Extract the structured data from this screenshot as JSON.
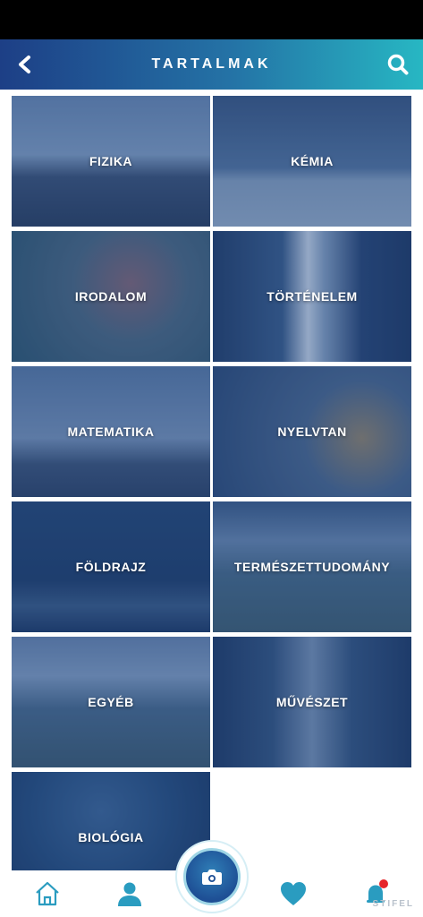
{
  "header": {
    "title": "TARTALMAK",
    "back_icon": "chevron-left-icon",
    "search_icon": "search-icon"
  },
  "categories": [
    {
      "label": "FIZIKA"
    },
    {
      "label": "KÉMIA"
    },
    {
      "label": "IRODALOM"
    },
    {
      "label": "TÖRTÉNELEM"
    },
    {
      "label": "MATEMATIKA"
    },
    {
      "label": "NYELVTAN"
    },
    {
      "label": "FÖLDRAJZ"
    },
    {
      "label": "TERMÉSZETTUDOMÁNY"
    },
    {
      "label": "EGYÉB"
    },
    {
      "label": "MŰVÉSZET"
    },
    {
      "label": "BIOLÓGIA"
    }
  ],
  "bottom_nav": {
    "items": [
      "home-icon",
      "user-icon",
      "camera-icon",
      "heart-icon",
      "notification-icon"
    ]
  },
  "watermark": "STIFEL",
  "colors": {
    "header_start": "#1d3f86",
    "header_end": "#27b7c3",
    "nav_icon": "#2a9cc0",
    "notification_dot": "#e5252a"
  }
}
